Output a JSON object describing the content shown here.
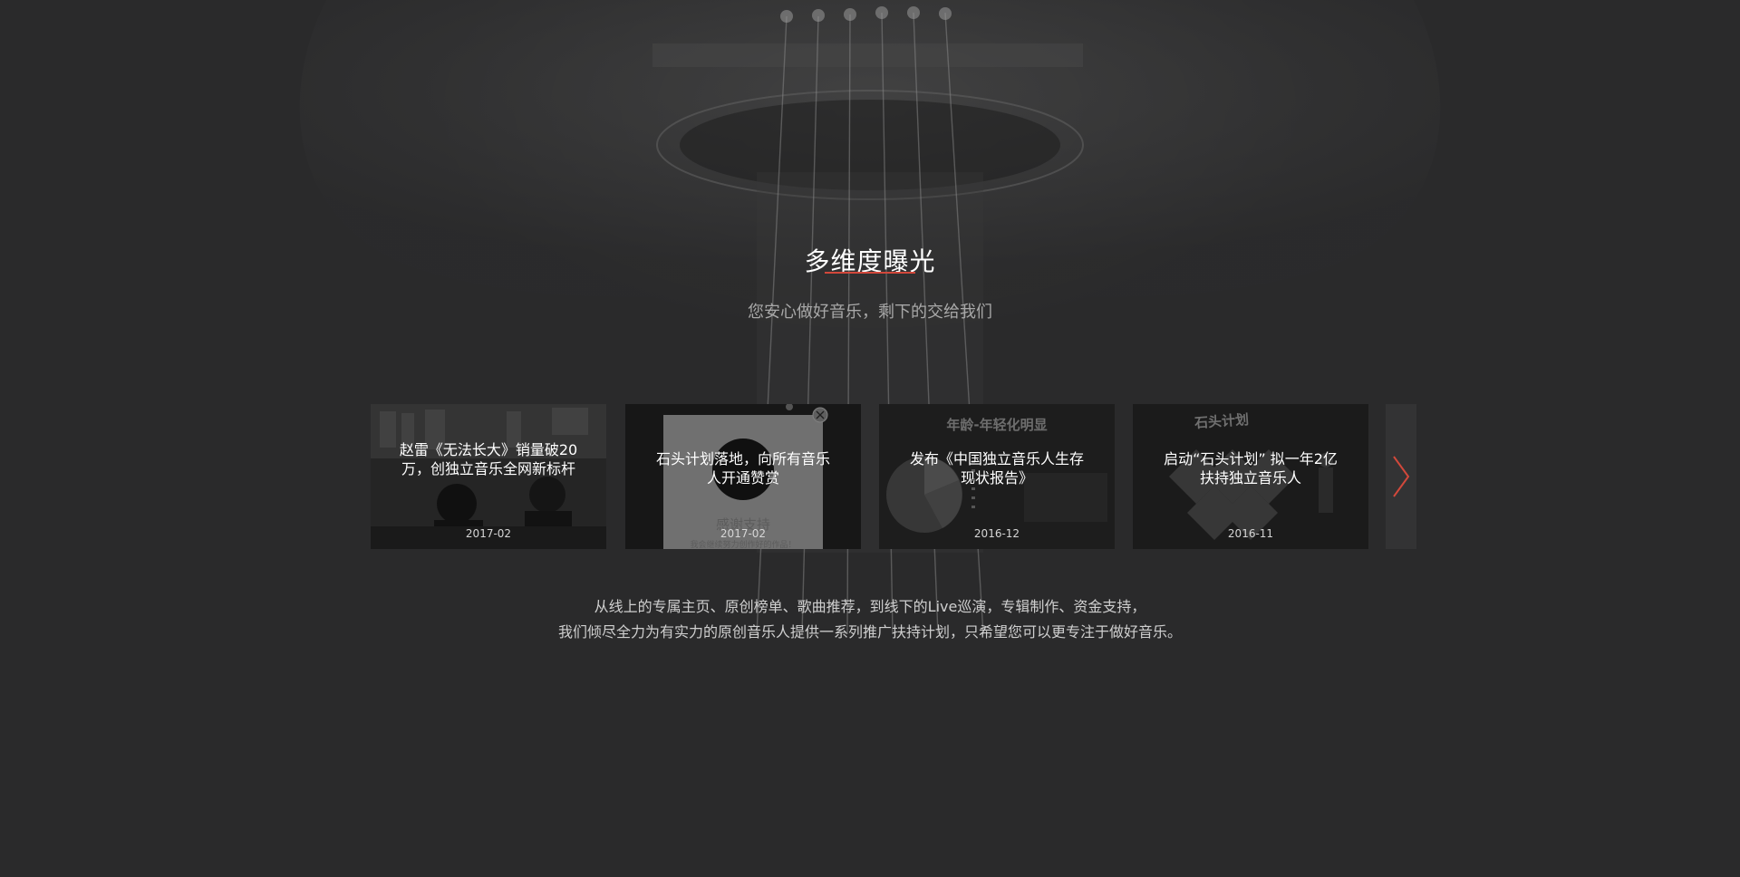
{
  "section": {
    "title": "多维度曝光",
    "subtitle": "您安心做好音乐，剩下的交给我们",
    "accent_color": "#d2483b"
  },
  "cards": [
    {
      "title": "赵雷《无法长大》销量破20万，创独立音乐全网新标杆",
      "date": "2017-02"
    },
    {
      "title": "石头计划落地，向所有音乐人开通赞赏",
      "date": "2017-02",
      "overlay_heading": "感谢支持",
      "overlay_note": "我会继续努力创作好的作品！"
    },
    {
      "title": "发布《中国独立音乐人生存现状报告》",
      "date": "2016-12",
      "overlay_heading": "年龄-年轻化明显"
    },
    {
      "title": "启动“石头计划” 拟一年2亿扶持独立音乐人",
      "date": "2016-11",
      "overlay_heading": "石头计划"
    }
  ],
  "carousel": {
    "next_icon": "chevron-right-icon"
  },
  "description": {
    "line1": "从线上的专属主页、原创榜单、歌曲推荐，到线下的Live巡演，专辑制作、资金支持，",
    "line2": "我们倾尽全力为有实力的原创音乐人提供一系列推广扶持计划，只希望您可以更专注于做好音乐。"
  }
}
